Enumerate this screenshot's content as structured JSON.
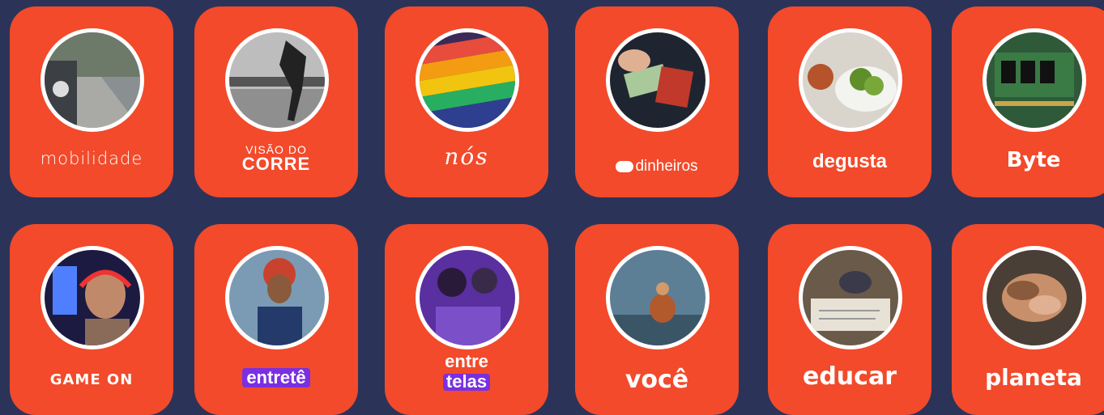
{
  "colors": {
    "background": "#2c3358",
    "card": "#f24a2b",
    "accent_purple": "#7a2fe0"
  },
  "channels": {
    "mobilidade": {
      "label": "mobilidade",
      "image": "car-on-street-photo"
    },
    "corre": {
      "label_top": "VISÃO DO",
      "label_bottom": "CORRE",
      "image": "runner-bw-photo"
    },
    "nos": {
      "label": "nós",
      "image": "rainbow-flag-crowd-photo"
    },
    "dinheiros": {
      "label": "dinheiros",
      "image": "money-wallet-photo"
    },
    "degusta": {
      "label": "degusta",
      "image": "salad-bowl-photo"
    },
    "byte": {
      "label": "Byte",
      "image": "memory-chip-photo"
    },
    "gameon": {
      "label": "GAME ON",
      "image": "gamer-headset-photo"
    },
    "entretece": {
      "label": "entretê",
      "image": "smiling-woman-photo"
    },
    "entretelas": {
      "label_top": "entre",
      "label_bottom": "telas",
      "image": "couple-movie-photo"
    },
    "voce": {
      "label": "você",
      "image": "meditating-person-photo"
    },
    "educar": {
      "label": "educar",
      "image": "writing-notes-photo"
    },
    "planeta": {
      "label": "planeta",
      "image": "stacked-hands-photo"
    }
  }
}
